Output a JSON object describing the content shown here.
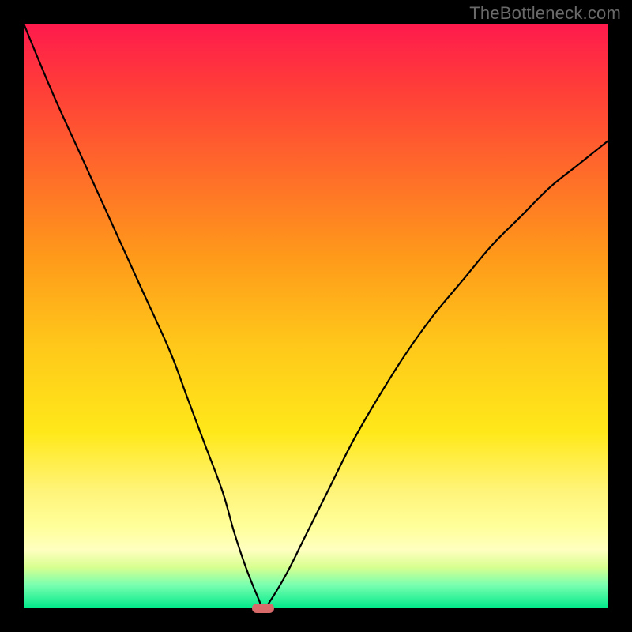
{
  "watermark": "TheBottleneck.com",
  "chart_data": {
    "type": "line",
    "title": "",
    "xlabel": "",
    "ylabel": "",
    "xlim": [
      0,
      100
    ],
    "ylim": [
      0,
      100
    ],
    "gradient_stops": [
      {
        "pos": 0,
        "color": "#ff1a4d"
      },
      {
        "pos": 25,
        "color": "#ff6a2a"
      },
      {
        "pos": 55,
        "color": "#ffc81a"
      },
      {
        "pos": 86,
        "color": "#ffff9a"
      },
      {
        "pos": 100,
        "color": "#00e98a"
      }
    ],
    "series": [
      {
        "name": "bottleneck-curve",
        "x": [
          0,
          5,
          10,
          15,
          20,
          25,
          28,
          31,
          34,
          36,
          38,
          40,
          41,
          42,
          45,
          48,
          52,
          56,
          60,
          65,
          70,
          75,
          80,
          85,
          90,
          95,
          100
        ],
        "values": [
          100,
          88,
          77,
          66,
          55,
          44,
          36,
          28,
          20,
          13,
          7,
          2,
          0,
          1,
          6,
          12,
          20,
          28,
          35,
          43,
          50,
          56,
          62,
          67,
          72,
          76,
          80
        ]
      }
    ],
    "marker": {
      "x": 41,
      "y": 0,
      "color": "#d86a6a"
    }
  }
}
